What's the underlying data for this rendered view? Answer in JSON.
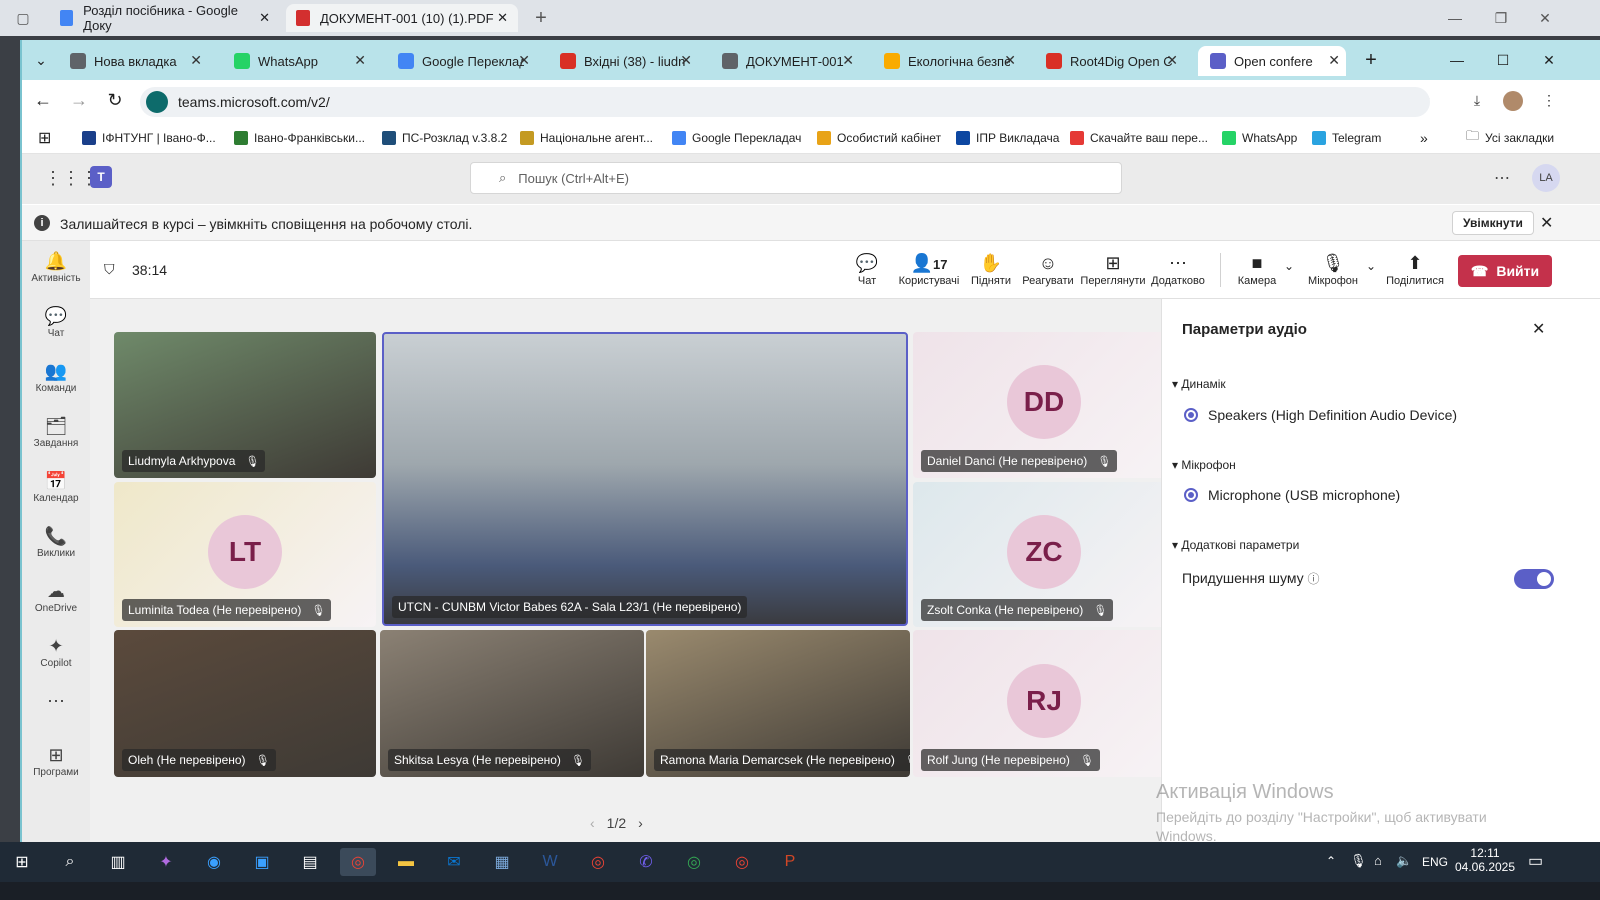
{
  "outer_tabs": [
    {
      "label": "Розділ посібника - Google Доку"
    },
    {
      "label": "ДОКУМЕНТ-001 (10) (1).PDF"
    }
  ],
  "chrome_tabs": [
    {
      "label": "Нова вкладка",
      "icon": "chrome-icon",
      "color": "#5f6368"
    },
    {
      "label": "WhatsApp",
      "icon": "whatsapp-icon",
      "color": "#25d366"
    },
    {
      "label": "Google Переклад",
      "icon": "translate-icon",
      "color": "#4285f4"
    },
    {
      "label": "Вхідні (38) - liudn",
      "icon": "gmail-icon",
      "color": "#d93025"
    },
    {
      "label": "ДОКУМЕНТ-001 (",
      "icon": "globe-icon",
      "color": "#5f6368"
    },
    {
      "label": "Екологічна безпе",
      "icon": "doc-icon",
      "color": "#f9ab00"
    },
    {
      "label": "Root4Dig Open C",
      "icon": "gmail-icon",
      "color": "#d93025"
    },
    {
      "label": "Open confere",
      "icon": "teams-icon",
      "color": "#5b5fc7"
    }
  ],
  "url": "teams.microsoft.com/v2/",
  "bookmarks": [
    {
      "label": "ІФНТУНГ | Івано-Ф...",
      "color": "#1a3f8a"
    },
    {
      "label": "Івано-Франківськи...",
      "color": "#2e7d32"
    },
    {
      "label": "ПС-Розклад v.3.8.2",
      "color": "#1f4e79"
    },
    {
      "label": "Національне агент...",
      "color": "#c49a22"
    },
    {
      "label": "Google Перекладач",
      "color": "#4285f4"
    },
    {
      "label": "Особистий кабінет",
      "color": "#e8a317"
    },
    {
      "label": "ІПР Викладача",
      "color": "#0d47a1"
    },
    {
      "label": "Скачайте ваш пере...",
      "color": "#e53935"
    },
    {
      "label": "WhatsApp",
      "color": "#25d366"
    },
    {
      "label": "Telegram",
      "color": "#2aa3e0"
    }
  ],
  "all_bookmarks": "Усі закладки",
  "teams": {
    "search_placeholder": "Пошук (Ctrl+Alt+E)",
    "avatar": "LA"
  },
  "notification": {
    "text": "Залишайтеся в курсі – увімкніть сповіщення на робочому столі.",
    "button": "Увімкнути"
  },
  "rail": [
    {
      "label": "Активність",
      "icon": "bell-icon",
      "glyph": "🔔"
    },
    {
      "label": "Чат",
      "icon": "chat-icon",
      "glyph": "💬"
    },
    {
      "label": "Команди",
      "icon": "teams-group-icon",
      "glyph": "👥"
    },
    {
      "label": "Завдання",
      "icon": "tasks-icon",
      "glyph": "🗂"
    },
    {
      "label": "Календар",
      "icon": "calendar-icon",
      "glyph": "📅"
    },
    {
      "label": "Виклики",
      "icon": "phone-icon",
      "glyph": "📞"
    },
    {
      "label": "OneDrive",
      "icon": "cloud-icon",
      "glyph": "☁"
    },
    {
      "label": "Copilot",
      "icon": "copilot-icon",
      "glyph": "✦"
    },
    {
      "label": "",
      "icon": "more-icon",
      "glyph": "⋯"
    },
    {
      "label": "Програми",
      "icon": "apps-icon",
      "glyph": "⊞"
    }
  ],
  "meeting": {
    "timer": "38:14",
    "participants": "17",
    "buttons": {
      "chat": "Чат",
      "people": "Користувачі",
      "raise": "Підняти",
      "react": "Реагувати",
      "view": "Переглянути",
      "more": "Додатково",
      "camera": "Камера",
      "mic": "Мікрофон",
      "share": "Поділитися",
      "leave": "Вийти"
    },
    "page": "1/2"
  },
  "tiles": [
    {
      "name": "Liudmyla Arkhypova",
      "kind": "video",
      "bg": "#6f8a6a"
    },
    {
      "name": "Luminita Todea (Не перевірено)",
      "initials": "LT",
      "bg": "#efe8c9"
    },
    {
      "name": "UTCN - CUNBM Victor Babes 62A - Sala L23/1 (Не перевірено)",
      "kind": "video",
      "bg": "#8a9aa8"
    },
    {
      "name": "Daniel Danci (Не перевірено)",
      "initials": "DD",
      "bg": "#efe3e9"
    },
    {
      "name": "Zsolt Conka (Не перевірено)",
      "initials": "ZC",
      "bg": "#dde8ec"
    },
    {
      "name": "Oleh (Не перевірено)",
      "kind": "video",
      "bg": "#5b4a3c"
    },
    {
      "name": "Shkitsa Lesya (Не перевірено)",
      "kind": "video",
      "bg": "#8b8174"
    },
    {
      "name": "Ramona Maria Demarcsek (Не перевірено)",
      "kind": "video",
      "bg": "#9a8a6e"
    },
    {
      "name": "Rolf Jung (Не перевірено)",
      "initials": "RJ",
      "bg": "#efe3e9"
    }
  ],
  "audio": {
    "title": "Параметри аудіо",
    "speaker_heading": "Динамік",
    "speaker": "Speakers (High Definition Audio Device)",
    "mic_heading": "Мікрофон",
    "mic": "Microphone (USB microphone)",
    "extra_heading": "Додаткові параметри",
    "noise": "Придушення шуму",
    "noise_on": true
  },
  "watermark": {
    "title": "Активація Windows",
    "text": "Перейдіть до розділу \"Настройки\", щоб активувати Windows."
  },
  "taskbar": {
    "lang": "ENG",
    "time": "12:11",
    "date": "04.06.2025"
  }
}
